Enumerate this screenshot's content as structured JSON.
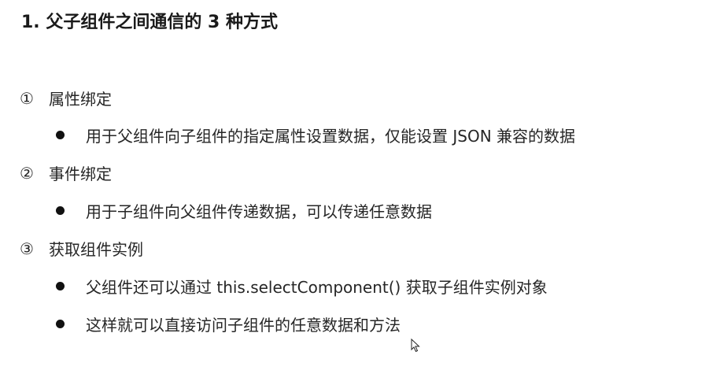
{
  "title": "1. 父子组件之间通信的 3 种方式",
  "sections": [
    {
      "marker": "①",
      "label": "属性绑定",
      "bullets": [
        "用于父组件向子组件的指定属性设置数据，仅能设置 JSON 兼容的数据"
      ]
    },
    {
      "marker": "②",
      "label": "事件绑定",
      "bullets": [
        "用于子组件向父组件传递数据，可以传递任意数据"
      ]
    },
    {
      "marker": "③",
      "label": "获取组件实例",
      "bullets": [
        "父组件还可以通过 this.selectComponent() 获取子组件实例对象",
        "这样就可以直接访问子组件的任意数据和方法"
      ]
    }
  ],
  "icons": {
    "bullet": "filled-circle",
    "cursor": "mouse-pointer-icon"
  }
}
